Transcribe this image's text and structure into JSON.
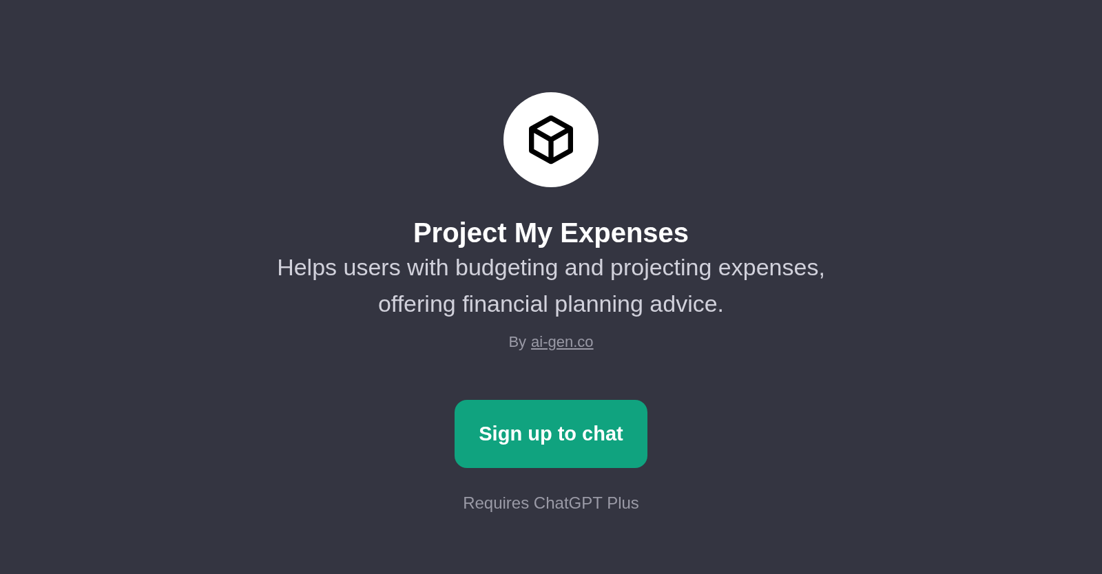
{
  "title": "Project My Expenses",
  "description": "Helps users with budgeting and projecting expenses, offering financial planning advice.",
  "byline": {
    "prefix": "By",
    "link": "ai-gen.co"
  },
  "button": "Sign up to chat",
  "note": "Requires ChatGPT Plus"
}
